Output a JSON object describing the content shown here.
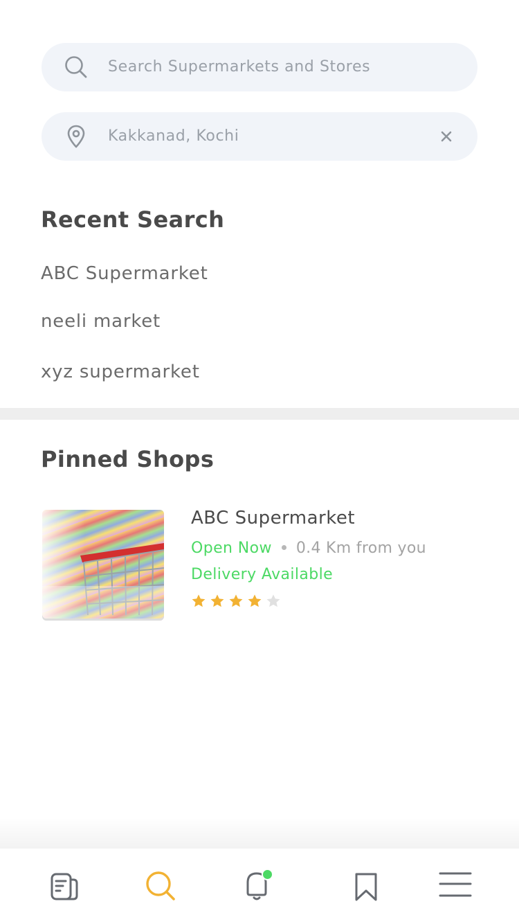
{
  "search": {
    "placeholder": "Search Supermarkets and Stores",
    "location_value": "Kakkanad, Kochi"
  },
  "recent": {
    "title": "Recent Search",
    "items": [
      "ABC Supermarket",
      "neeli market",
      "xyz supermarket"
    ]
  },
  "pinned": {
    "title": "Pinned Shops",
    "shops": [
      {
        "name": "ABC Supermarket",
        "status": "Open Now",
        "distance": "0.4 Km from you",
        "delivery": "Delivery Available",
        "rating": 4,
        "rating_max": 5
      }
    ]
  },
  "nav": {
    "items": [
      "orders-icon",
      "search-icon",
      "notifications-icon",
      "bookmark-icon",
      "menu-icon"
    ],
    "active": "search-icon",
    "notification_badge": true
  },
  "colors": {
    "accent": "#f2b233",
    "success": "#4cd964",
    "field_bg": "#f1f4f9",
    "star_on": "#f2b233",
    "star_off": "#e0e0e0"
  }
}
